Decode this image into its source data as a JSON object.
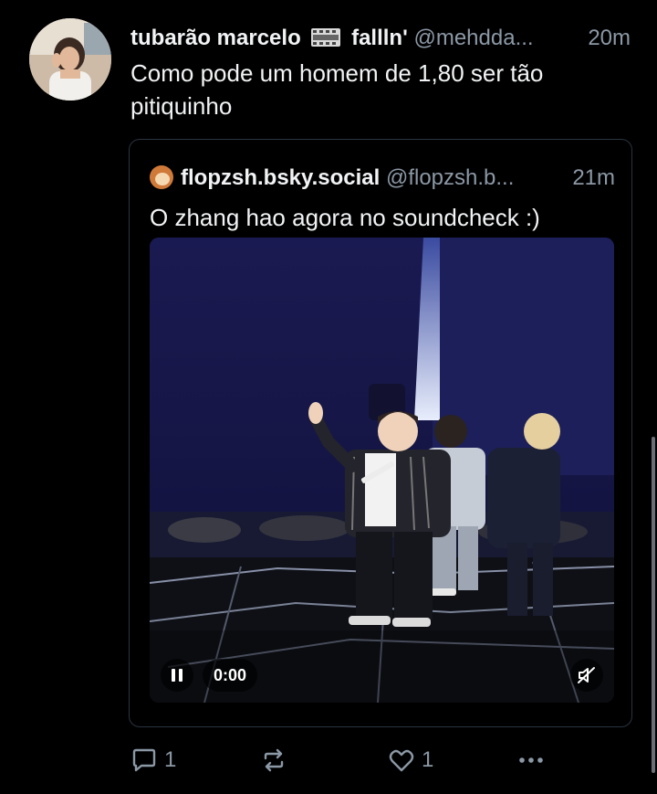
{
  "post": {
    "author": {
      "display_name_before": "tubarão marcelo",
      "display_name_after": "fallln'",
      "name_icon": "film-strip-icon",
      "handle": "@mehdda...",
      "time": "20m"
    },
    "text": "Como pode um homem de 1,80 ser tão pitiquinho",
    "quote": {
      "author": {
        "display_name": "flopzsh.bsky.social",
        "handle": "@flopzsh.b...",
        "time": "21m"
      },
      "text": "O zhang hao agora no soundcheck :)",
      "video": {
        "time": "0:00",
        "controls": [
          "pause-icon",
          "muted-speaker-icon"
        ]
      }
    },
    "actions": {
      "reply_count": "1",
      "like_count": "1",
      "icons": [
        "reply-icon",
        "repost-icon",
        "like-icon",
        "more-icon"
      ]
    }
  },
  "colors": {
    "background": "#000000",
    "text": "#f1f3f5",
    "muted": "#8b98a5",
    "card_border": "#2a3440"
  }
}
